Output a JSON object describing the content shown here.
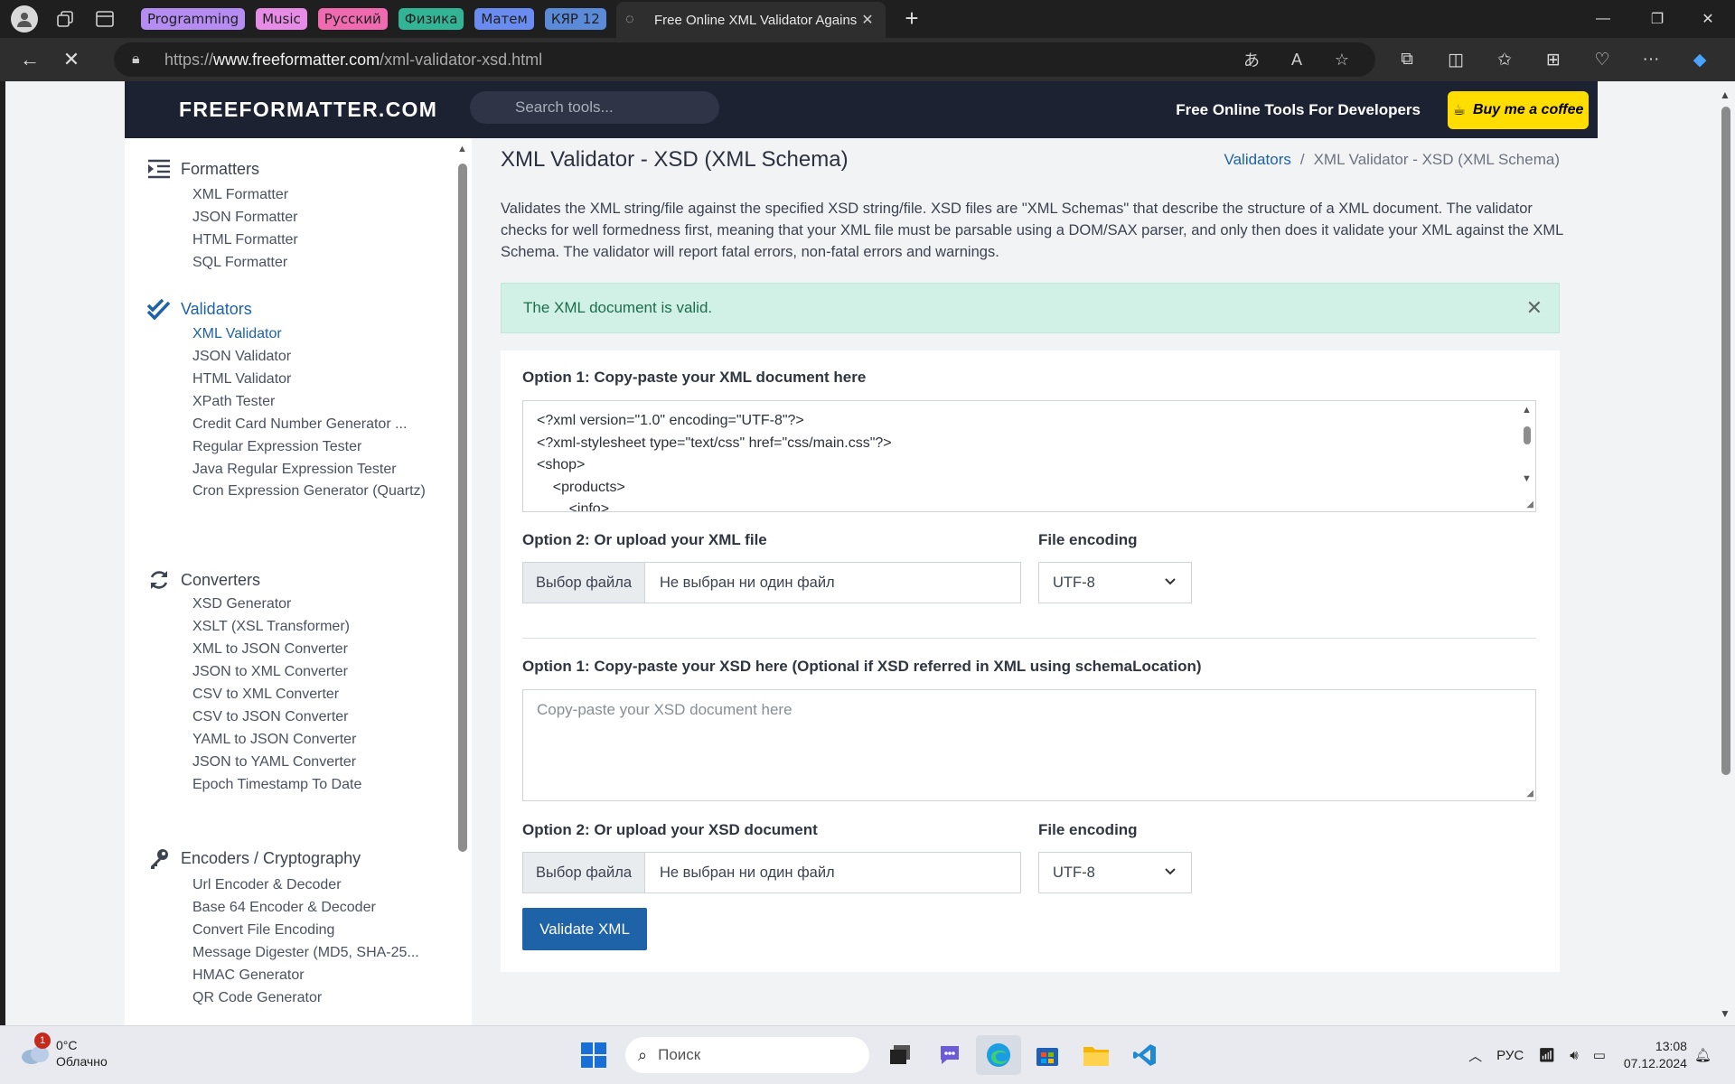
{
  "browser": {
    "tab_groups": [
      {
        "label": "Programming",
        "bg": "#b48cf2",
        "fg": "#1f1f1f"
      },
      {
        "label": "Music",
        "bg": "#e68ce6",
        "fg": "#1f1f1f"
      },
      {
        "label": "Русский",
        "bg": "#f06ab0",
        "fg": "#1f1f1f"
      },
      {
        "label": "Физика",
        "bg": "#32b496",
        "fg": "#1f1f1f"
      },
      {
        "label": "Матем",
        "bg": "#6a8cf0",
        "fg": "#1f1f1f"
      },
      {
        "label": "КЯР 12",
        "bg": "#5a8ad8",
        "fg": "#1f1f1f"
      }
    ],
    "active_tab_title": "Free Online XML Validator Agains",
    "url_prefix": "https://",
    "url_host": "www.freeformatter.com",
    "url_path": "/xml-validator-xsd.html"
  },
  "site": {
    "logo": "FREEFORMATTER.COM",
    "search_placeholder": "Search tools...",
    "tagline": "Free Online Tools For Developers",
    "coffee_label": "Buy me a coffee"
  },
  "sidebar": {
    "sections": [
      {
        "label": "Formatters",
        "icon": "list-indent-icon"
      },
      {
        "label": "Validators",
        "icon": "double-check-icon"
      },
      {
        "label": "Converters",
        "icon": "refresh-icon"
      },
      {
        "label": "Encoders / Cryptography",
        "icon": "key-icon"
      }
    ],
    "formatters": [
      "XML Formatter",
      "JSON Formatter",
      "HTML Formatter",
      "SQL Formatter"
    ],
    "validators": [
      "XML Validator",
      "JSON Validator",
      "HTML Validator",
      "XPath Tester",
      "Credit Card Number Generator ...",
      "Regular Expression Tester",
      "Java Regular Expression Tester",
      "Cron Expression Generator (Quartz)"
    ],
    "converters": [
      "XSD Generator",
      "XSLT (XSL Transformer)",
      "XML to JSON Converter",
      "JSON to XML Converter",
      "CSV to XML Converter",
      "CSV to JSON Converter",
      "YAML to JSON Converter",
      "JSON to YAML Converter",
      "Epoch Timestamp To Date"
    ],
    "encoders": [
      "Url Encoder & Decoder",
      "Base 64 Encoder & Decoder",
      "Convert File Encoding",
      "Message Digester (MD5, SHA-25...",
      "HMAC Generator",
      "QR Code Generator"
    ]
  },
  "main": {
    "title": "XML Validator - XSD (XML Schema)",
    "breadcrumb_link": "Validators",
    "breadcrumb_separator": "/",
    "breadcrumb_current": "XML Validator - XSD (XML Schema)",
    "description": "Validates the XML string/file against the specified XSD string/file. XSD files are \"XML Schemas\" that describe the structure of a XML document. The validator checks for well formedness first, meaning that your XML file must be parsable using a DOM/SAX parser, and only then does it validate your XML against the XML Schema. The validator will report fatal errors, non-fatal errors and warnings.",
    "alert": "The XML document is valid.",
    "xml_label": "Option 1: Copy-paste your XML document here",
    "xml_lines": [
      "<?xml version=\"1.0\" encoding=\"UTF-8\"?>",
      "<?xml-stylesheet type=\"text/css\" href=\"css/main.css\"?>",
      "<shop>",
      "    <products>",
      "        <info>"
    ],
    "xml_upload_label": "Option 2: Or upload your XML file",
    "encoding_label": "File encoding",
    "file_button": "Выбор файла",
    "file_none": "Не выбран ни один файл",
    "encoding_value": "UTF-8",
    "xsd_label": "Option 1: Copy-paste your XSD here (Optional if XSD referred in XML using schemaLocation)",
    "xsd_placeholder": "Copy-paste your XSD document here",
    "xsd_upload_label": "Option 2: Or upload your XSD document",
    "validate_button": "Validate XML"
  },
  "taskbar": {
    "weather_temp": "0°C",
    "weather_desc": "Облачно",
    "weather_badge": "1",
    "search_label": "Поиск",
    "lang": "РУС",
    "time": "13:08",
    "date": "07.12.2024"
  }
}
